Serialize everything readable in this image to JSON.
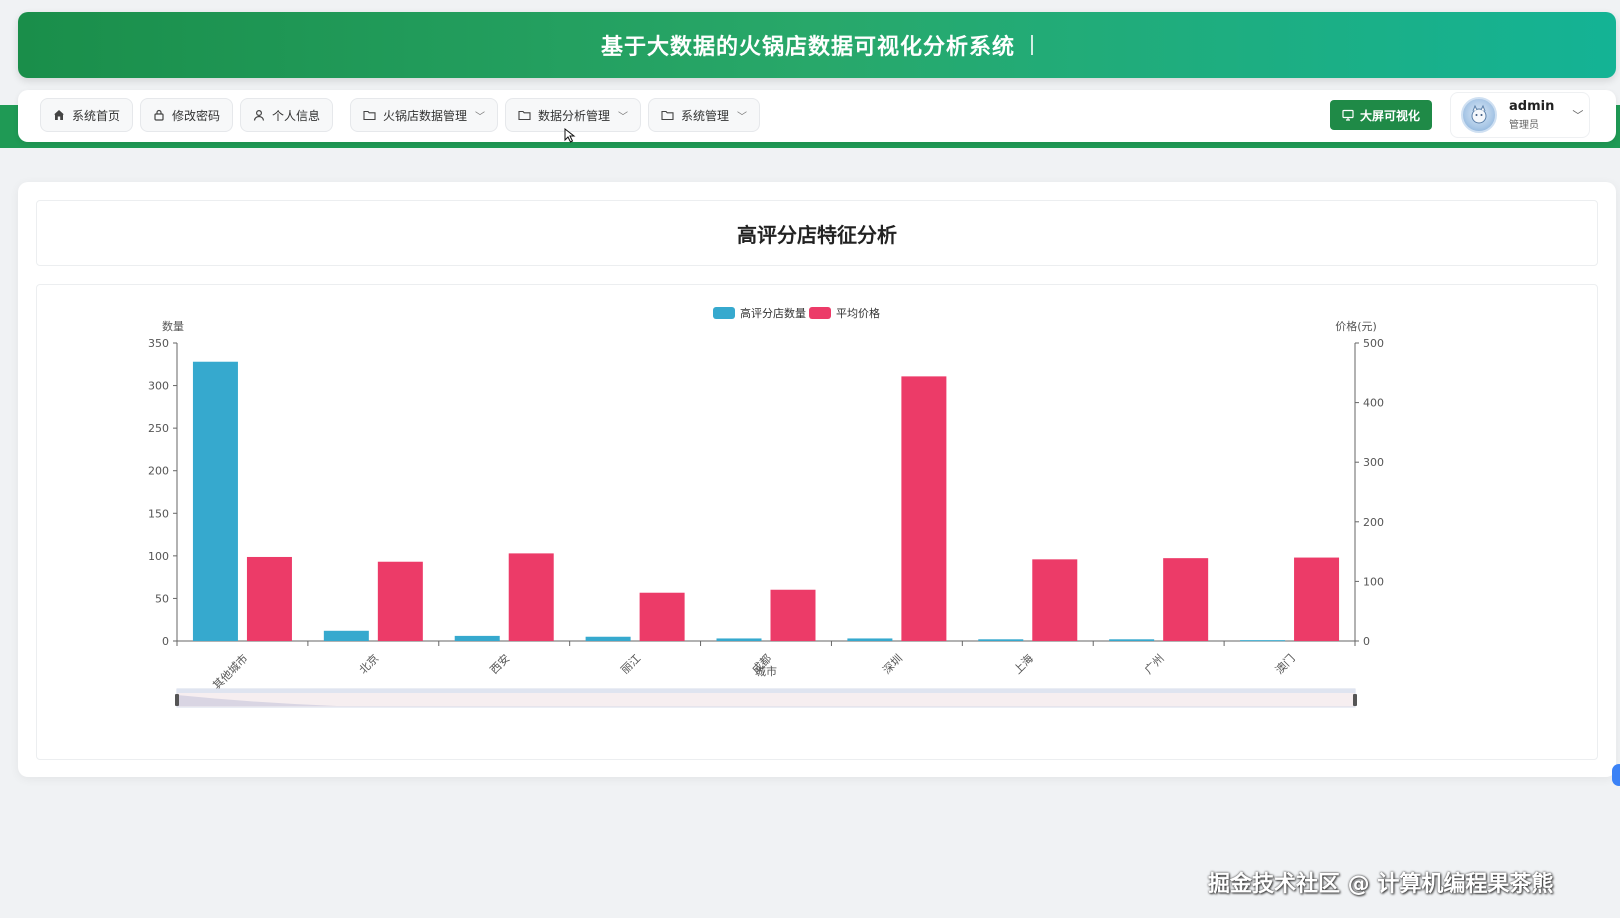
{
  "header": {
    "title": "基于大数据的火锅店数据可视化分析系统"
  },
  "nav": {
    "items": [
      {
        "label": "系统首页",
        "icon": "home-icon",
        "dropdown": false
      },
      {
        "label": "修改密码",
        "icon": "lock-icon",
        "dropdown": false
      },
      {
        "label": "个人信息",
        "icon": "user-icon",
        "dropdown": false
      },
      {
        "label": "火锅店数据管理",
        "icon": "folder-icon",
        "dropdown": true
      },
      {
        "label": "数据分析管理",
        "icon": "folder-icon",
        "dropdown": true
      },
      {
        "label": "系统管理",
        "icon": "folder-icon",
        "dropdown": true
      }
    ],
    "big_screen_label": "大屏可视化",
    "user": {
      "name": "admin",
      "role": "管理员"
    }
  },
  "page": {
    "title": "高评分店特征分析"
  },
  "colors": {
    "brand_green": "#1f8a47",
    "series_count": "#36a9ce",
    "series_price": "#ec3b68"
  },
  "chart_data": {
    "type": "bar",
    "legend_position": "top-center",
    "xlabel": "城市",
    "categories": [
      "其他城市",
      "北京",
      "西安",
      "丽江",
      "成都",
      "深圳",
      "上海",
      "广州",
      "澳门"
    ],
    "y_left": {
      "label": "数量",
      "ylim": [
        0,
        350
      ],
      "ticks": [
        0,
        50,
        100,
        150,
        200,
        250,
        300,
        350
      ]
    },
    "y_right": {
      "label": "价格(元)",
      "ylim": [
        0,
        500
      ],
      "ticks": [
        0,
        100,
        200,
        300,
        400,
        500
      ]
    },
    "grid": false,
    "series": [
      {
        "name": "高评分店数量",
        "axis": "left",
        "values": [
          328,
          12,
          6,
          5,
          3,
          3,
          2,
          2,
          1
        ]
      },
      {
        "name": "平均价格",
        "axis": "right",
        "values": [
          141,
          133,
          147,
          81,
          86,
          444,
          137,
          139,
          140
        ]
      }
    ],
    "data_zoom": true
  },
  "watermark": "掘金技术社区 @ 计算机编程果茶熊"
}
